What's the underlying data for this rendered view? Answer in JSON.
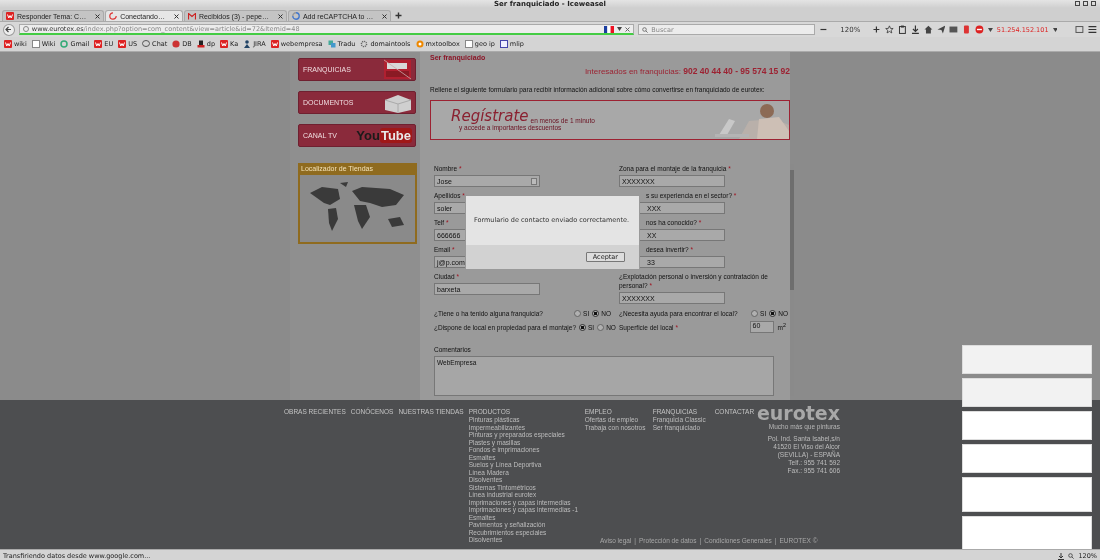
{
  "window": {
    "title": "Ser franquiciado - Iceweasel"
  },
  "tabs": [
    {
      "label": "Responder Tema: C…",
      "selected": false
    },
    {
      "label": "Conectando…",
      "selected": true
    },
    {
      "label": "Recibidos (3) - pepe…",
      "selected": false
    },
    {
      "label": "Add reCAPTCHA to …",
      "selected": false
    }
  ],
  "toolbar": {
    "url_host": "www.eurotex.es",
    "url_path": "/index.php?option=com_content&view=article&id=72&Itemid=48",
    "search_placeholder": "Buscar",
    "zoom": "120%",
    "ip": "51.254.152.101"
  },
  "bookmarks": [
    "wiki",
    "Wiki",
    "Gmail",
    "EU",
    "US",
    "Chat",
    "DB",
    "dp",
    "Ka",
    "JIRA",
    "webempresa",
    "Tradu",
    "domaintools",
    "mxtoolbox",
    "geo ip",
    "mlip"
  ],
  "sidebar": {
    "banners": [
      {
        "label": "FRANQUICIAS"
      },
      {
        "label": "DOCUMENTOS"
      },
      {
        "label": "CANAL TV",
        "logo_a": "You",
        "logo_b": "Tube"
      }
    ],
    "locator_title": "Localizador de Tiendas"
  },
  "main": {
    "title": "Ser franquiciado",
    "phone_label": "Interesados en franquicias:",
    "phones": "902 40 44 40 - 95 574 15 92",
    "intro": "Rellene el siguiente formulario para recibir información adicional sobre cómo convertirse en franquiciado de eurotex:",
    "banner": {
      "title": "Regístrate",
      "line1": "en menos de 1 minuto",
      "line2": "y accede a importantes descuentos"
    }
  },
  "form": {
    "left": [
      {
        "label": "Nombre",
        "mark": "*",
        "value": "Jose"
      },
      {
        "label": "Apellidos",
        "mark": "*",
        "value": "soler"
      },
      {
        "label": "Telf",
        "mark": "*",
        "value": "666666"
      },
      {
        "label": "Email",
        "mark": "*",
        "value": "j@p.com"
      },
      {
        "label": "Ciudad",
        "mark": "*",
        "value": "barxeta"
      }
    ],
    "right": [
      {
        "label": "Zona para el montaje de la franquicia",
        "mark": "*",
        "value": "XXXXXXX"
      },
      {
        "label": "s su experiencia en el sector?",
        "mark": "*",
        "value": "XXX"
      },
      {
        "label": "nos ha conocido?",
        "mark": "*",
        "value": "XX"
      },
      {
        "label": "desea invertir?",
        "mark": "*",
        "value": "33"
      },
      {
        "label": "¿Explotación personal o inversión y contratación de personal?",
        "mark": "*",
        "value": "XXXXXXX"
      }
    ],
    "questions": [
      {
        "label": "¿Tiene o ha tenido alguna franquicia?",
        "options": [
          {
            "label": "SI",
            "selected": false
          },
          {
            "label": "NO",
            "selected": true
          }
        ]
      },
      {
        "label": "¿Necesita ayuda para encontrar el local?",
        "options": [
          {
            "label": "SI",
            "selected": false
          },
          {
            "label": "NO",
            "selected": true
          }
        ]
      },
      {
        "label": "¿Dispone de local en propiedad para el montaje?",
        "options": [
          {
            "label": "SI",
            "selected": true
          },
          {
            "label": "NO",
            "selected": false
          }
        ]
      }
    ],
    "surface": {
      "label": "Superficie del local",
      "mark": "*",
      "value": "60",
      "unit": "m$^{2}$"
    },
    "comments": {
      "label": "Comentarios",
      "value": "WebEmpresa"
    }
  },
  "footer": {
    "menu": [
      "OBRAS RECIENTES",
      "CONÓCENOS",
      "NUESTRAS TIENDAS"
    ],
    "products": {
      "title": "PRODUCTOS",
      "items": [
        "Pinturas plásticas",
        "Impermeabilizantes",
        "Pinturas y preparados especiales",
        "Plastes y masillas",
        "Fondos e imprimaciones",
        "Esmaltes",
        "Suelos y Línea Deportiva",
        "Línea Madera",
        "Disolventes",
        "Sistemas Tintométricos",
        "Línea industrial eurotex",
        "Imprimaciones y capas intermedias",
        "Imprimaciones y capas intermedias -1",
        "Esmaltes",
        "Pavimentos y señalización",
        "Recubrimientos especiales",
        "Disolventes"
      ]
    },
    "empleo": {
      "title": "EMPLEO",
      "items": [
        "Ofertas de empleo",
        "Trabaja con nosotros"
      ]
    },
    "franquicias": {
      "title": "FRANQUICIAS",
      "items": [
        "Franquicia Classic",
        "Ser franquiciado"
      ]
    },
    "contact": "CONTACTAR",
    "logo": "eurotex",
    "tagline": "Mucho más que pinturas",
    "address": [
      "Pol. Ind. Santa Isabel,s/n",
      "41520 El Viso del Alcor",
      "(SEVILLA) - ESPAÑA",
      "Telf.: 955 741 592",
      "Fax.: 955 741 606"
    ],
    "legal": [
      "Aviso legal",
      "Protección de datos",
      "Condiciones Generales",
      "EUROTEX ©"
    ],
    "separator": "|"
  },
  "dialog": {
    "message": "Formulario de contacto enviado correctamente.",
    "button": "Aceptar"
  },
  "status_bar": {
    "text": "Transfiriendo datos desde www.google.com...",
    "zoom": "120%"
  }
}
